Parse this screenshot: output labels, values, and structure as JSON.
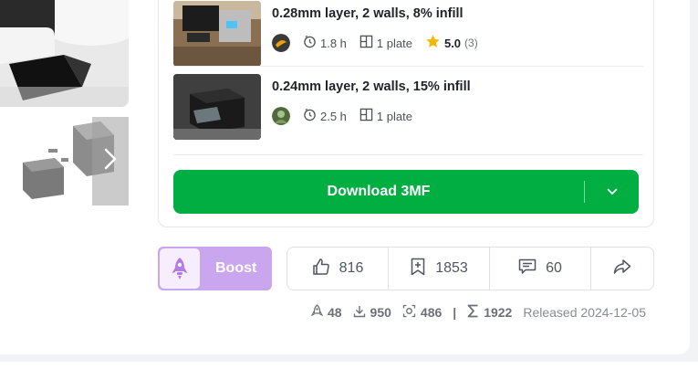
{
  "gallery": {
    "main_photo_alt": "",
    "thumb_next_icon": "chevron-right-icon"
  },
  "profiles": [
    {
      "title": "0.28mm layer, 2 walls, 8% infill",
      "print_time": "1.8 h",
      "plates": "1 plate",
      "rating": "5.0",
      "rating_count": "(3)"
    },
    {
      "title": "0.24mm layer, 2 walls, 15% infill",
      "print_time": "2.5 h",
      "plates": "1 plate"
    }
  ],
  "download": {
    "label": "Download 3MF"
  },
  "boost": {
    "label": "Boost"
  },
  "actions": {
    "likes": "816",
    "collections": "1853",
    "comments": "60"
  },
  "stats": {
    "boosts": "48",
    "downloads": "950",
    "prints": "486",
    "separator": "|",
    "total": "1922",
    "released": "Released 2024-12-05"
  },
  "colors": {
    "download_green": "#00ae42",
    "boost_purple": "#c9a6ee",
    "star_yellow": "#f5b800"
  }
}
